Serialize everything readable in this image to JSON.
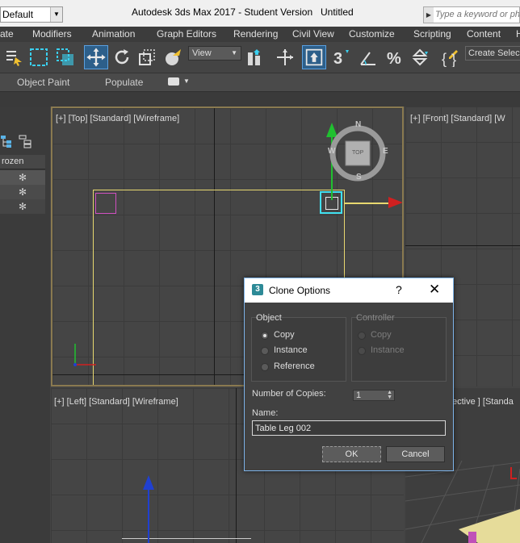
{
  "titlebar": {
    "workspace": "Default",
    "app_title": "Autodesk 3ds Max 2017 - Student Version",
    "doc_title": "Untitled",
    "search_placeholder": "Type a keyword or ph"
  },
  "menu": [
    "ate",
    "Modifiers",
    "Animation",
    "Graph Editors",
    "Rendering",
    "Civil View",
    "Customize",
    "Scripting",
    "Content",
    "H"
  ],
  "toolbar": {
    "view_select": "View",
    "create_selection": "Create Selec"
  },
  "ribbon": {
    "tabs": [
      "Object Paint",
      "Populate"
    ]
  },
  "explorer": {
    "column_header": "rozen",
    "rows": [
      "✻",
      "✻",
      "✻"
    ]
  },
  "viewports": {
    "top": "[+] [Top] [Standard] [Wireframe]",
    "front": "[+] [Front] [Standard] [W",
    "left": "[+] [Left] [Standard] [Wireframe]",
    "perspective": "ective ] [Standa"
  },
  "viewcube": {
    "n": "N",
    "s": "S",
    "e": "E",
    "w": "W",
    "face": "TOP"
  },
  "dialog": {
    "title": "Clone Options",
    "help": "?",
    "close": "✕",
    "object_group": "Object",
    "object_options": [
      "Copy",
      "Instance",
      "Reference"
    ],
    "object_selected": 0,
    "controller_group": "Controller",
    "controller_options": [
      "Copy",
      "Instance"
    ],
    "copies_label": "Number of Copies:",
    "copies_value": "1",
    "name_label": "Name:",
    "name_value": "Table Leg 002",
    "ok_label": "OK",
    "cancel_label": "Cancel"
  },
  "colors": {
    "accent": "#7eb4ea",
    "active_viewport_border": "#8a7a50",
    "selection_yellow": "#e8d870",
    "selected_box": "#40e0f0",
    "unselected_box": "#d050c0",
    "gizmo_x": "#d02020",
    "gizmo_y": "#20c030",
    "gizmo_z": "#2040d0"
  }
}
